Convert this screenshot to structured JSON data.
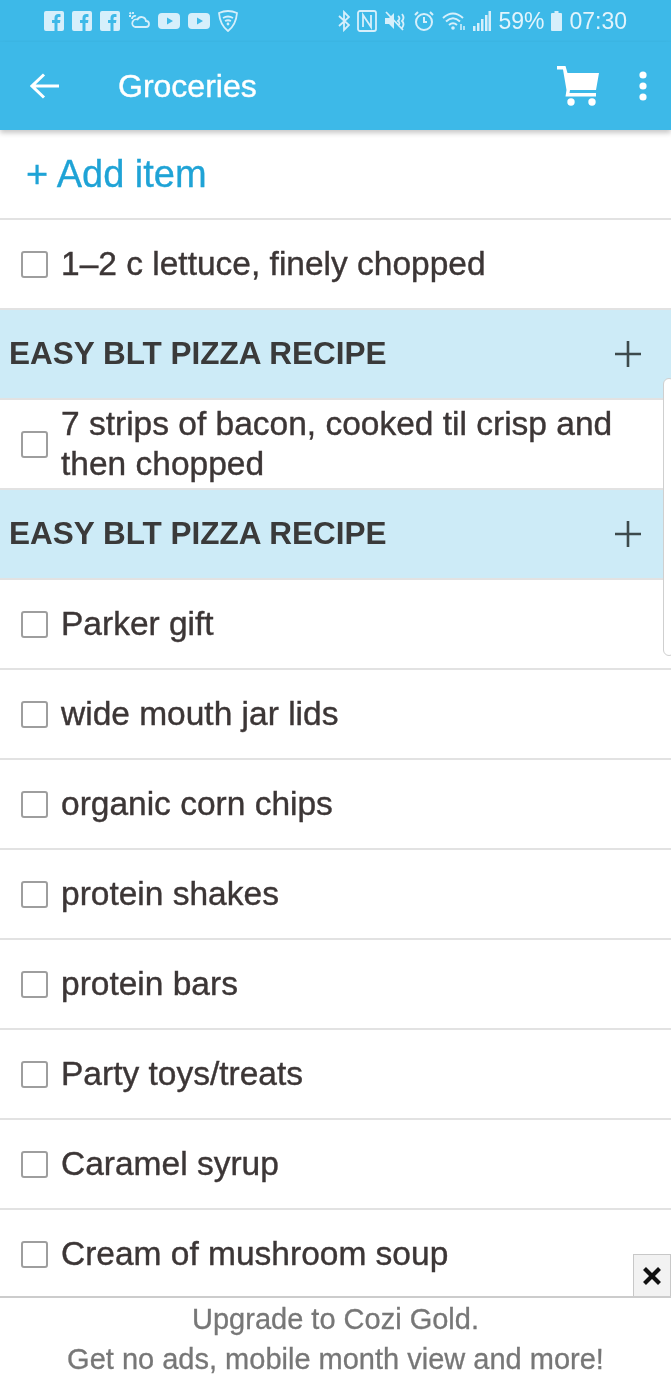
{
  "status_bar": {
    "battery": "59%",
    "time": "07:30"
  },
  "app_bar": {
    "title": "Groceries"
  },
  "add_item": {
    "label": "+ Add item"
  },
  "list": [
    {
      "kind": "item",
      "text": "1–2 c lettuce, finely chopped",
      "checked": false
    },
    {
      "kind": "header",
      "text": "EASY BLT PIZZA RECIPE"
    },
    {
      "kind": "item",
      "text": "7 strips of bacon, cooked til crisp and then chopped",
      "checked": false
    },
    {
      "kind": "header",
      "text": "EASY BLT PIZZA RECIPE"
    },
    {
      "kind": "item",
      "text": "Parker gift",
      "checked": false
    },
    {
      "kind": "item",
      "text": "wide mouth jar lids",
      "checked": false
    },
    {
      "kind": "item",
      "text": "organic corn chips",
      "checked": false
    },
    {
      "kind": "item",
      "text": "protein shakes",
      "checked": false
    },
    {
      "kind": "item",
      "text": "protein bars",
      "checked": false
    },
    {
      "kind": "item",
      "text": "Party toys/treats",
      "checked": false
    },
    {
      "kind": "item",
      "text": "Caramel syrup",
      "checked": false
    },
    {
      "kind": "item",
      "text": "Cream of mushroom soup",
      "checked": false
    }
  ],
  "ad_banner": {
    "lines": [
      "Upgrade to Cozi Gold.",
      "Get no ads, mobile month view and more!"
    ]
  }
}
